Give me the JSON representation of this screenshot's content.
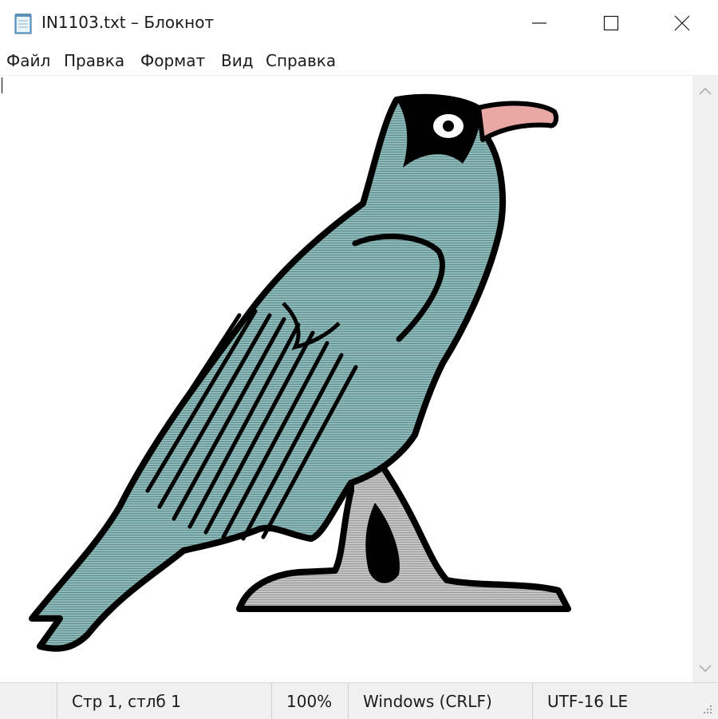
{
  "window": {
    "title": "IN1103.txt – Блокнот",
    "icon": "notepad-icon"
  },
  "controls": {
    "minimize_icon": "minimize-icon",
    "maximize_icon": "maximize-icon",
    "close_icon": "close-icon"
  },
  "menu": {
    "items": [
      "Файл",
      "Правка",
      "Формат",
      "Вид",
      "Справка"
    ]
  },
  "editor": {
    "content_description_icon": "ascii-art-bird",
    "colors": {
      "body": "#8fb9b8",
      "outline": "#000000",
      "beak": "#e8a8a4",
      "perch": "#bdbdbd",
      "background": "#ffffff"
    }
  },
  "statusbar": {
    "position": "Стр 1, стлб 1",
    "zoom": "100%",
    "line_endings": "Windows (CRLF)",
    "encoding": "UTF-16 LE"
  }
}
